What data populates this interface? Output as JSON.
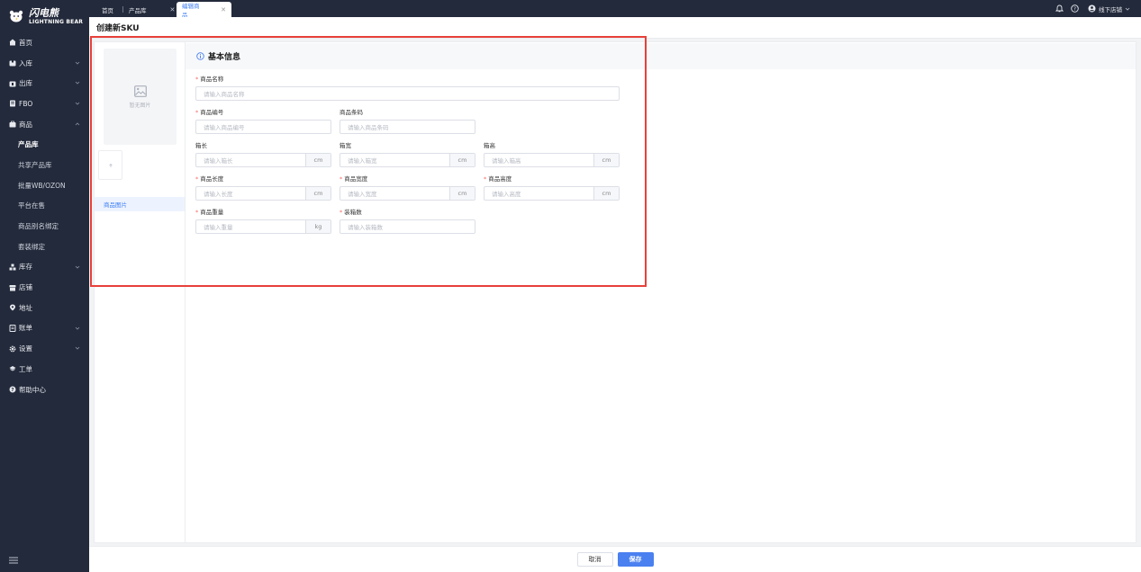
{
  "brand": {
    "name_cn": "闪电熊",
    "name_en": "LIGHTNING BEAR"
  },
  "sidebar": {
    "items": [
      {
        "label": "首页",
        "icon": "home-icon",
        "expandable": false
      },
      {
        "label": "入库",
        "icon": "inbound-icon",
        "expandable": true
      },
      {
        "label": "出库",
        "icon": "outbound-icon",
        "expandable": true
      },
      {
        "label": "FBO",
        "icon": "fbo-icon",
        "expandable": true
      },
      {
        "label": "商品",
        "icon": "goods-icon",
        "expandable": true,
        "expanded": true
      },
      {
        "label": "产品库",
        "sub": true,
        "active": true
      },
      {
        "label": "共享产品库",
        "sub": true
      },
      {
        "label": "批量WB/OZON",
        "sub": true
      },
      {
        "label": "平台在售",
        "sub": true
      },
      {
        "label": "商品别名绑定",
        "sub": true
      },
      {
        "label": "套装绑定",
        "sub": true
      },
      {
        "label": "库存",
        "icon": "inventory-icon",
        "expandable": true
      },
      {
        "label": "店铺",
        "icon": "store-icon",
        "expandable": false
      },
      {
        "label": "地址",
        "icon": "location-icon",
        "expandable": false
      },
      {
        "label": "账单",
        "icon": "bill-icon",
        "expandable": true
      },
      {
        "label": "设置",
        "icon": "settings-icon",
        "expandable": true
      },
      {
        "label": "工单",
        "icon": "ticket-icon",
        "expandable": false
      },
      {
        "label": "帮助中心",
        "icon": "help-icon",
        "expandable": false
      }
    ]
  },
  "tabs": [
    {
      "label": "首页",
      "closable": false,
      "active": false
    },
    {
      "label": "产品库",
      "closable": true,
      "active": false
    },
    {
      "label": "编辑商品",
      "closable": true,
      "active": true
    }
  ],
  "header": {
    "user": "线下店铺"
  },
  "page": {
    "title": "创建新SKU"
  },
  "image_panel": {
    "no_image": "暂无图片",
    "anchor": "商品图片"
  },
  "section": {
    "title": "基本信息"
  },
  "fields": {
    "name": {
      "label": "商品名称",
      "required": true,
      "placeholder": "请输入商品名称"
    },
    "code": {
      "label": "商品编号",
      "required": true,
      "placeholder": "请输入商品编号"
    },
    "barcode": {
      "label": "商品条码",
      "required": false,
      "placeholder": "请输入商品条码"
    },
    "box_length": {
      "label": "箱长",
      "required": false,
      "placeholder": "请输入箱长",
      "unit": "cm"
    },
    "box_width": {
      "label": "箱宽",
      "required": false,
      "placeholder": "请输入箱宽",
      "unit": "cm"
    },
    "box_height": {
      "label": "箱高",
      "required": false,
      "placeholder": "请输入箱高",
      "unit": "cm"
    },
    "length": {
      "label": "商品长度",
      "required": true,
      "placeholder": "请输入长度",
      "unit": "cm"
    },
    "width": {
      "label": "商品宽度",
      "required": true,
      "placeholder": "请输入宽度",
      "unit": "cm"
    },
    "height": {
      "label": "商品高度",
      "required": true,
      "placeholder": "请输入高度",
      "unit": "cm"
    },
    "weight": {
      "label": "商品重量",
      "required": true,
      "placeholder": "请输入重量",
      "unit": "kg"
    },
    "box_qty": {
      "label": "装箱数",
      "required": true,
      "placeholder": "请输入装箱数"
    }
  },
  "footer": {
    "cancel": "取消",
    "save": "保存"
  },
  "colors": {
    "sidebar_bg": "#232a3b",
    "accent": "#4a80f0",
    "highlight": "#e8403a",
    "required": "#f56c6c"
  }
}
